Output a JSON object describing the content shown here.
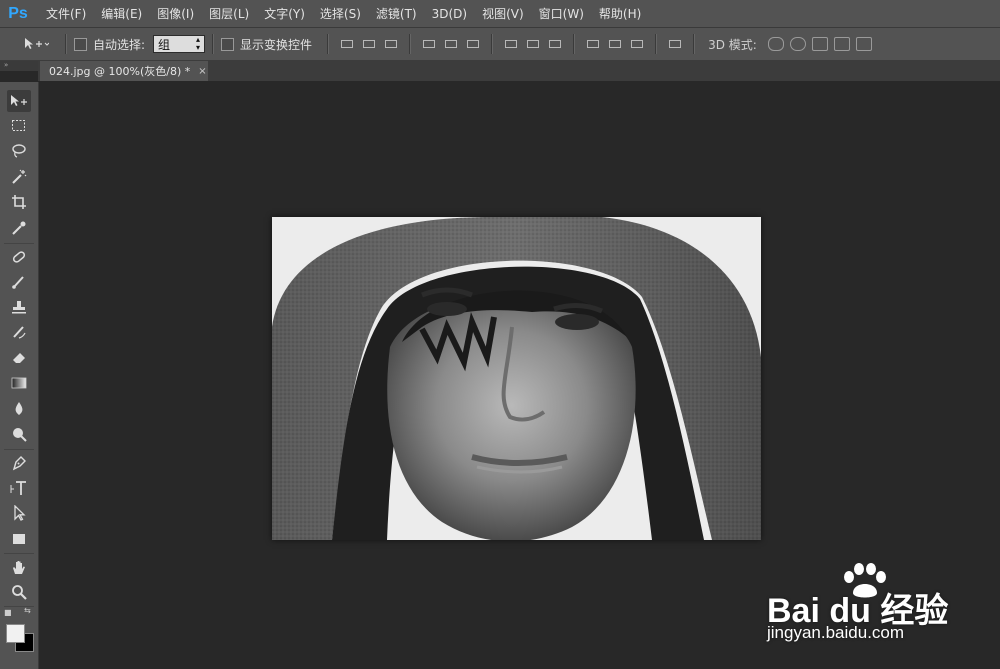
{
  "app": {
    "logo": "Ps"
  },
  "menu": [
    "文件(F)",
    "编辑(E)",
    "图像(I)",
    "图层(L)",
    "文字(Y)",
    "选择(S)",
    "滤镜(T)",
    "3D(D)",
    "视图(V)",
    "窗口(W)",
    "帮助(H)"
  ],
  "options": {
    "auto_select_label": "自动选择:",
    "auto_select_value": "组",
    "show_transform_label": "显示变换控件",
    "mode_3d_label": "3D 模式:"
  },
  "document": {
    "tab_title": "024.jpg @ 100%(灰色/8) *",
    "close": "×"
  },
  "panel_collapse": "»",
  "tools": [
    "move-tool",
    "marquee-tool",
    "lasso-tool",
    "magic-wand-tool",
    "crop-tool",
    "eyedropper-tool",
    "healing-brush-tool",
    "brush-tool",
    "clone-stamp-tool",
    "history-brush-tool",
    "eraser-tool",
    "gradient-tool",
    "blur-tool",
    "dodge-tool",
    "pen-tool",
    "type-tool",
    "path-selection-tool",
    "rectangle-tool",
    "hand-tool",
    "zoom-tool"
  ],
  "colors": {
    "foreground": "#f1f1f1",
    "background": "#000000",
    "accent": "#31a8ff"
  },
  "watermark": {
    "logo_text": "Bai du 经验",
    "url": "jingyan.baidu.com"
  }
}
